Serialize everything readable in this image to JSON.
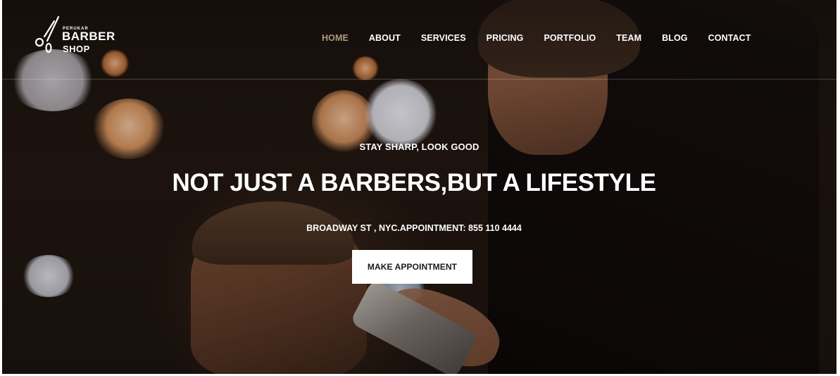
{
  "logo": {
    "small_text": "PERUKAR",
    "main_text": "BARBER",
    "sub_text": "SHOP",
    "icon": "scissors-icon"
  },
  "nav": {
    "items": [
      {
        "label": "HOME",
        "active": true
      },
      {
        "label": "ABOUT",
        "active": false
      },
      {
        "label": "SERVICES",
        "active": false
      },
      {
        "label": "PRICING",
        "active": false
      },
      {
        "label": "PORTFOLIO",
        "active": false
      },
      {
        "label": "TEAM",
        "active": false
      },
      {
        "label": "BLOG",
        "active": false
      },
      {
        "label": "CONTACT",
        "active": false
      }
    ],
    "active_color": "#b09a82"
  },
  "hero": {
    "tagline": "STAY SHARP, LOOK GOOD",
    "headline": "NOT JUST A BARBERS,BUT A LIFESTYLE",
    "info": "BROADWAY ST , NYC.APPOINTMENT: 855 110 4444",
    "cta_label": "MAKE APPOINTMENT"
  }
}
